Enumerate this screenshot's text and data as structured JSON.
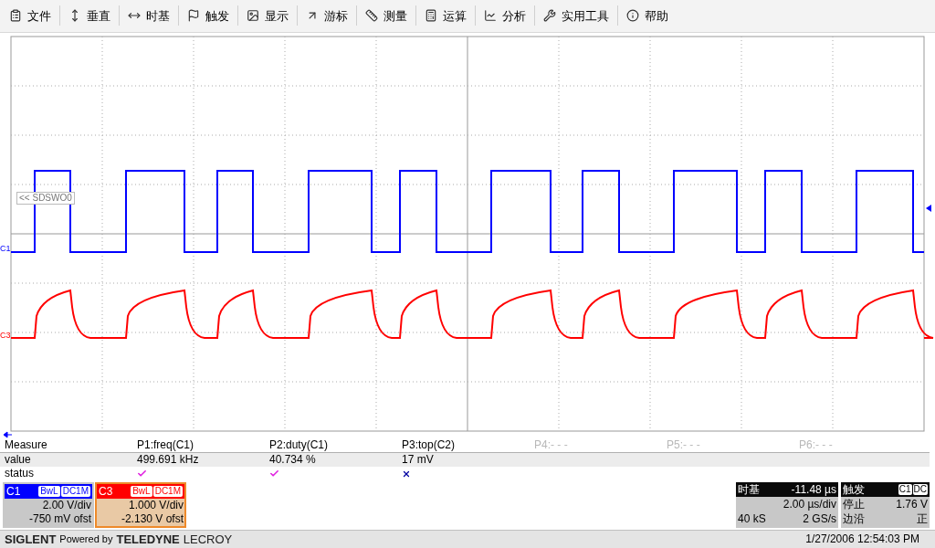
{
  "menu": [
    {
      "label": "文件"
    },
    {
      "label": "垂直"
    },
    {
      "label": "时基"
    },
    {
      "label": "触发"
    },
    {
      "label": "显示"
    },
    {
      "label": "游标"
    },
    {
      "label": "测量"
    },
    {
      "label": "运算"
    },
    {
      "label": "分析"
    },
    {
      "label": "实用工具"
    },
    {
      "label": "帮助"
    }
  ],
  "scope": {
    "ref_label": "<< SDSWO0",
    "traces": [
      {
        "name": "C1",
        "color": "#0000ff"
      },
      {
        "name": "C3",
        "color": "#ff0000"
      }
    ]
  },
  "measure": {
    "header": "Measure",
    "value_label": "value",
    "status_label": "status",
    "params": [
      {
        "label": "P1:freq(C1)",
        "value": "499.691 kHz",
        "kind": "ok",
        "disabled": false
      },
      {
        "label": "P2:duty(C1)",
        "value": "40.734 %",
        "kind": "ok",
        "disabled": false
      },
      {
        "label": "P3:top(C2)",
        "value": "17 mV",
        "kind": "error",
        "disabled": false
      },
      {
        "label": "P4:- - -",
        "kind": "none",
        "disabled": true
      },
      {
        "label": "P5:- - -",
        "kind": "none",
        "disabled": true
      },
      {
        "label": "P6:- - -",
        "kind": "none",
        "disabled": true
      }
    ]
  },
  "channels": [
    {
      "name": "C1",
      "color": "#0000ff",
      "tags": [
        "BwL",
        "DC1M"
      ],
      "vdiv": "2.00 V/div",
      "offset": "-750 mV ofst",
      "selected": false
    },
    {
      "name": "C3",
      "color": "#ff0000",
      "tags": [
        "BwL",
        "DC1M"
      ],
      "vdiv": "1.000 V/div",
      "offset": "-2.130 V ofst",
      "selected": true
    }
  ],
  "timebase": {
    "title": "时基",
    "delay": "-11.48 µs",
    "tdiv": "2.00 µs/div",
    "samples": "40 kS",
    "rate": "2 GS/s"
  },
  "trigger": {
    "title": "触发",
    "tags": [
      "C1",
      "DC"
    ],
    "mode_label": "停止",
    "level": "1.76 V",
    "type_label": "边沿",
    "slope": "正"
  },
  "footer": {
    "brand": "SIGLENT",
    "powered": "Powered by",
    "maker": "TELEDYNE",
    "maker2": "LECROY",
    "timestamp": "1/27/2006 12:54:03 PM"
  }
}
